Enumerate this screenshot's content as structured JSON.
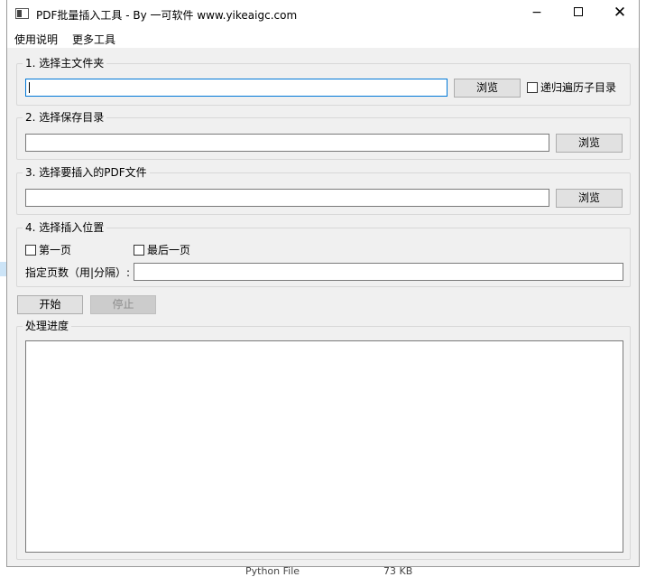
{
  "window": {
    "title": "PDF批量插入工具 - By 一可软件 www.yikeaigc.com"
  },
  "window_controls": {
    "minimize": "−",
    "maximize": "",
    "close": "✕"
  },
  "menu": {
    "items": [
      "使用说明",
      "更多工具"
    ]
  },
  "section1": {
    "title": "1. 选择主文件夹",
    "input_value": "",
    "browse_label": "浏览",
    "recursive_label": "递归遍历子目录"
  },
  "section2": {
    "title": "2. 选择保存目录",
    "input_value": "",
    "browse_label": "浏览"
  },
  "section3": {
    "title": "3. 选择要插入的PDF文件",
    "input_value": "",
    "browse_label": "浏览"
  },
  "section4": {
    "title": "4. 选择插入位置",
    "first_page_label": "第一页",
    "last_page_label": "最后一页",
    "pages_label": "指定页数（用|分隔）:",
    "pages_value": ""
  },
  "actions": {
    "start_label": "开始",
    "stop_label": "停止"
  },
  "progress": {
    "title": "处理进度",
    "log_text": ""
  },
  "background_file": {
    "type": "Python File",
    "size": "73 KB"
  },
  "icons": {
    "app": "app-window-icon",
    "minimize": "minimize-icon",
    "maximize": "maximize-icon",
    "close": "close-icon"
  }
}
